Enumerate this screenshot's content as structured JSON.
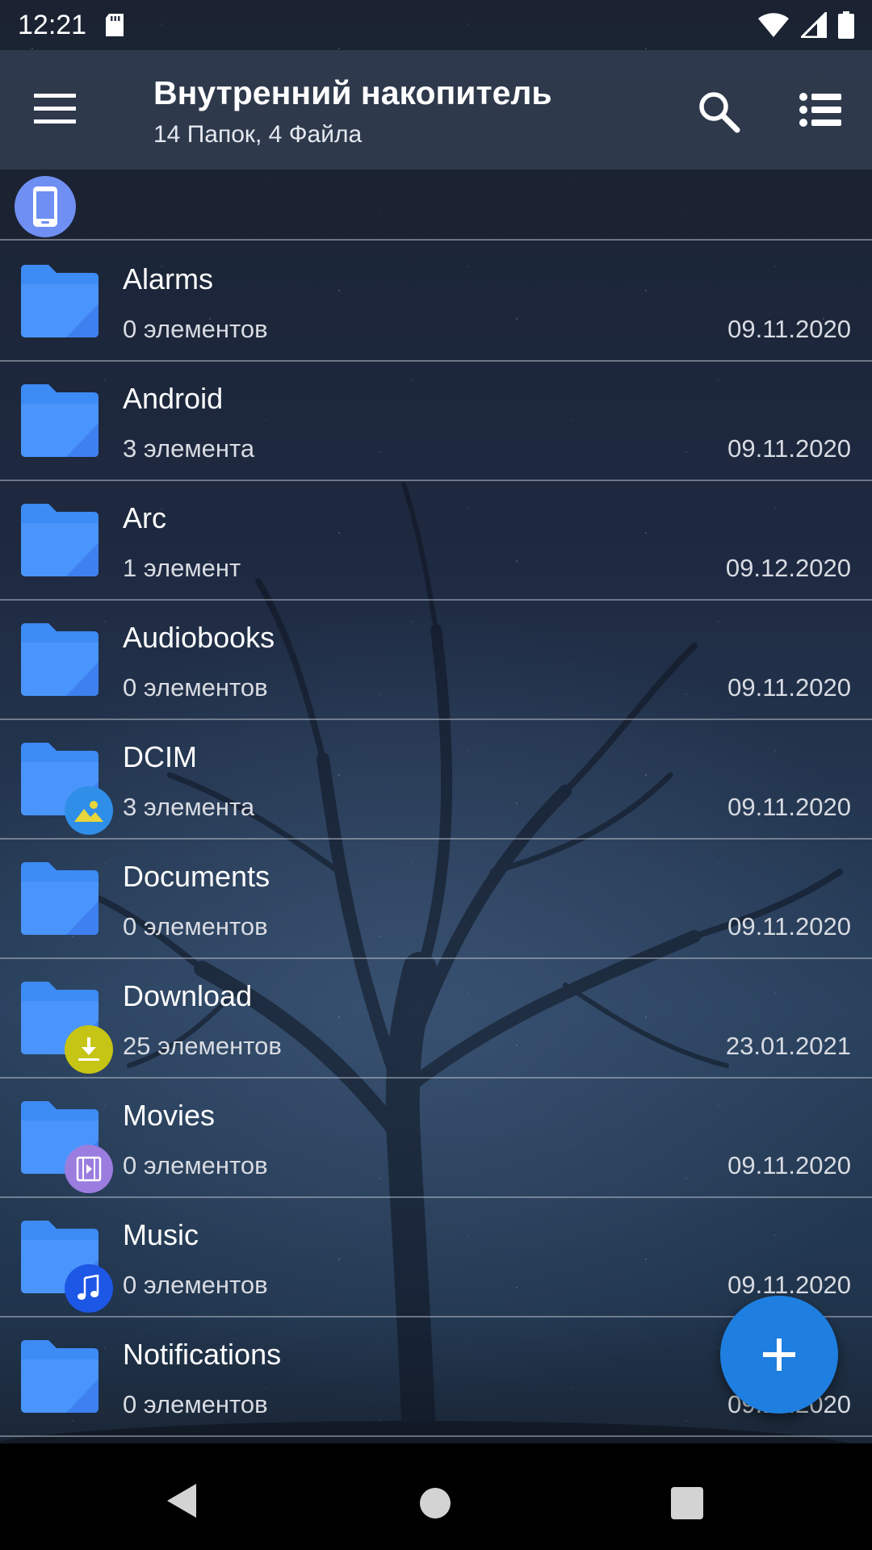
{
  "status_bar": {
    "time": "12:21",
    "icons": [
      "sd-card-icon",
      "wifi-icon",
      "signal-icon",
      "battery-icon"
    ]
  },
  "app_bar": {
    "title": "Внутренний накопитель",
    "subtitle": "14 Папок, 4 Файла",
    "icons": [
      "menu-icon",
      "search-icon",
      "list-view-icon"
    ]
  },
  "breadcrumb": {
    "root_icon": "phone-icon"
  },
  "files": [
    {
      "name": "Alarms",
      "count": "0 элементов",
      "date": "09.11.2020",
      "badge": null
    },
    {
      "name": "Android",
      "count": "3 элемента",
      "date": "09.11.2020",
      "badge": null
    },
    {
      "name": "Arc",
      "count": "1 элемент",
      "date": "09.12.2020",
      "badge": null
    },
    {
      "name": "Audiobooks",
      "count": "0 элементов",
      "date": "09.11.2020",
      "badge": null
    },
    {
      "name": "DCIM",
      "count": "3 элемента",
      "date": "09.11.2020",
      "badge": "image-icon"
    },
    {
      "name": "Documents",
      "count": "0 элементов",
      "date": "09.11.2020",
      "badge": null
    },
    {
      "name": "Download",
      "count": "25 элементов",
      "date": "23.01.2021",
      "badge": "download-icon"
    },
    {
      "name": "Movies",
      "count": "0 элементов",
      "date": "09.11.2020",
      "badge": "movie-icon"
    },
    {
      "name": "Music",
      "count": "0 элементов",
      "date": "09.11.2020",
      "badge": "music-icon"
    },
    {
      "name": "Notifications",
      "count": "0 элементов",
      "date": "09.11.2020",
      "badge": null
    }
  ],
  "fab": {
    "icon": "plus-icon"
  },
  "nav_bar": {
    "icons": [
      "back-icon",
      "home-icon",
      "recents-icon"
    ]
  },
  "colors": {
    "folder": "#3d8bf5",
    "fab": "#1e7fe0",
    "image_badge": "#2f8fe8",
    "download_badge": "#c6c414",
    "movie_badge": "#9b7de0",
    "music_badge": "#1d57e6",
    "storage_chip": "#6f8ff3"
  }
}
